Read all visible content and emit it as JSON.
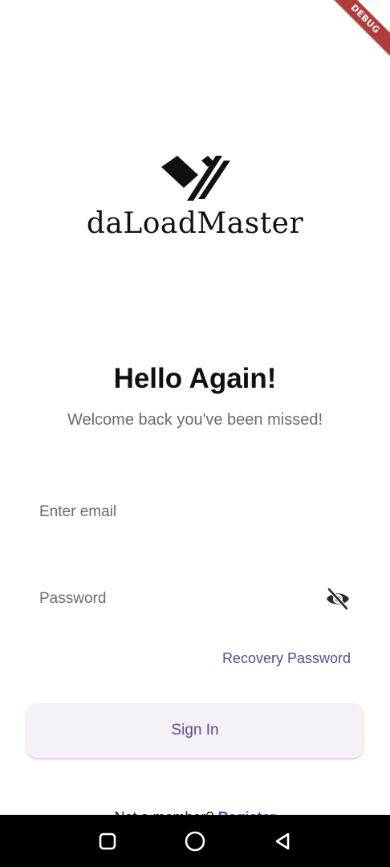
{
  "debug_banner": "DEBUG",
  "app": {
    "logo_text": "daLoadMaster",
    "logo_icon": "daloadmaster-logo-icon"
  },
  "header": {
    "title": "Hello Again!",
    "subtitle": "Welcome back you've been missed!"
  },
  "form": {
    "email_placeholder": "Enter email",
    "email_value": "",
    "password_placeholder": "Password",
    "password_value": "",
    "password_toggle_icon": "eye-off-icon",
    "recovery_label": "Recovery Password",
    "signin_label": "Sign In"
  },
  "footer": {
    "register_prompt": "Not a member?",
    "register_link": "Register"
  },
  "navbar": {
    "recents_icon": "recents-square-icon",
    "home_icon": "home-circle-icon",
    "back_icon": "back-triangle-icon"
  },
  "colors": {
    "accent": "#5b4b95",
    "button_bg": "#f6f0f8",
    "subtitle": "#6b6b6b",
    "link": "#3a5cc4",
    "debug_ribbon": "#b23a3a"
  }
}
